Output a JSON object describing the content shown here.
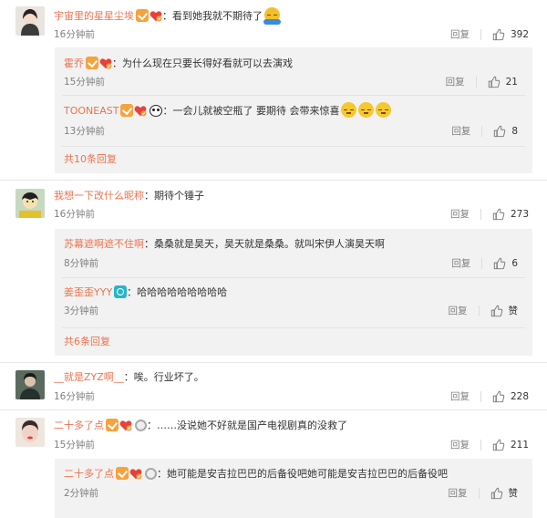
{
  "common": {
    "reply_label": "回复",
    "colon": "："
  },
  "comments": [
    {
      "user": "宇宙里的星星尘埃",
      "text": "看到她我就不期待了",
      "time": "16分钟前",
      "likes": "392",
      "replies": [
        {
          "user": "霍乔",
          "text": "为什么现在只要长得好看就可以去演戏",
          "time": "15分钟前",
          "likes": "21"
        },
        {
          "user": "TOONEAST",
          "text": "一会儿就被空瓶了  要期待 会带来惊喜",
          "time": "13分钟前",
          "likes": "8"
        }
      ],
      "more": "共10条回复"
    },
    {
      "user": "我想一下改什么昵称",
      "text": "期待个锤子",
      "time": "16分钟前",
      "likes": "273",
      "replies": [
        {
          "user": "苏幕遮啊遮不住啊",
          "text": "桑桑就是昊天，昊天就是桑桑。就叫宋伊人演昊天啊",
          "time": "8分钟前",
          "likes": "6"
        },
        {
          "user": "姜歪歪YYY",
          "text": "哈哈哈哈哈哈哈哈哈",
          "time": "3分钟前",
          "likes": "赞"
        }
      ],
      "more": "共6条回复"
    },
    {
      "user": "__就是ZYZ啊__",
      "text": "唉。行业坏了。",
      "time": "16分钟前",
      "likes": "228"
    },
    {
      "user": "二十多了点",
      "text": "……没说她不好就是国产电视剧真的没救了",
      "time": "15分钟前",
      "likes": "211",
      "replies": [
        {
          "user": "二十多了点",
          "text": "她可能是安吉拉巴巴的后备役吧她可能是安吉拉巴巴的后备役吧",
          "time": "2分钟前",
          "likes": "赞"
        }
      ]
    }
  ],
  "colors": {
    "username": "#eb7350",
    "subbox_bg": "#f2f2f2",
    "text": "#333333",
    "meta": "#808080",
    "vip_badge": "#f7a23b",
    "heart": "#e8413a"
  },
  "icons": {
    "like": "thumbs-up-icon",
    "vip": "vip-badge-icon",
    "fan": "heart-badge-icon"
  }
}
